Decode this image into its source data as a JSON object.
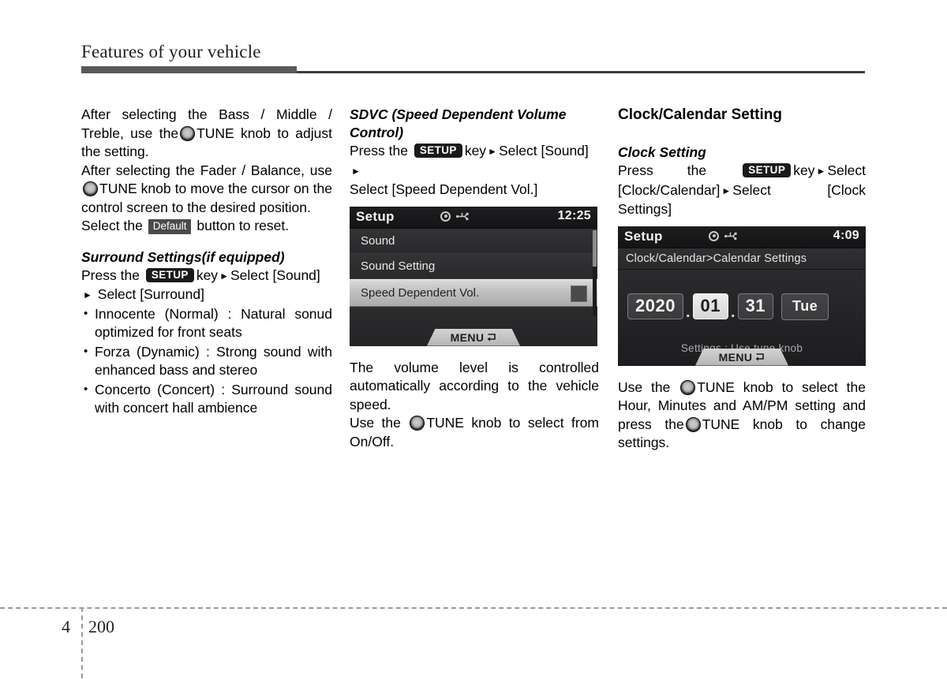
{
  "header": {
    "title": "Features of your vehicle"
  },
  "footer": {
    "chapter": "4",
    "page": "200"
  },
  "left_column": {
    "para1_a": "After selecting the Bass / Middle / Treble, use the",
    "para1_knob": "tune-knob",
    "para1_b": "TUNE knob to adjust the setting.",
    "para2_a": "After selecting the Fader / Balance, use",
    "para2_b": "TUNE knob to move the cursor on the control screen to the desired position.",
    "para3_a": "Select the",
    "para3_badge": "Default",
    "para3_b": "button to reset.",
    "surround_heading": "Surround Settings(if equipped)",
    "surround_press": "Press the",
    "surround_key": "SETUP",
    "surround_step1": "key",
    "surround_step2": "Select [Sound]",
    "surround_step3": "Select [Surround]",
    "surround_items": [
      "Innocente (Normal) : Natural sonud optimized for front seats",
      "Forza (Dynamic) : Strong sound with enhanced bass and stereo",
      "Concerto (Concert) : Surround sound with concert hall ambience"
    ]
  },
  "middle_column": {
    "sdvc_heading": "SDVC (Speed Dependent Volume Control)",
    "sdvc_press": "Press the",
    "sdvc_key": "SETUP",
    "sdvc_step1": "key",
    "sdvc_step2": "Select [Sound]",
    "sdvc_step3": "Select [Speed Dependent Vol.]",
    "caption_a": "The volume level is controlled automatically according to the vehicle speed.",
    "caption_b_pre": "Use  the",
    "caption_b_post": "TUNE knob to select from On/Off."
  },
  "middle_screen": {
    "title": "Setup",
    "time": "12:25",
    "disc_icon": "disc-icon",
    "usb_icon": "usb-icon",
    "rows": [
      {
        "label": "Sound",
        "selected": false
      },
      {
        "label": "Sound Setting",
        "selected": false
      },
      {
        "label": "Speed Dependent Vol.",
        "selected": true
      }
    ],
    "menu_label": "MENU"
  },
  "right_column": {
    "section_heading": "Clock/Calendar Setting",
    "clock_heading": "Clock Setting",
    "clock_press": "Press  the",
    "clock_key": "SETUP",
    "clock_step1": "key",
    "clock_step2": "Select  [Clock/Calendar]",
    "clock_step3": "Select [Clock Settings]",
    "caption_pre": "Use   the",
    "caption_mid": "TUNE knob to select the Hour, Minutes and AM/PM setting and press the",
    "caption_post": "TUNE knob to change settings."
  },
  "right_screen": {
    "title": "Setup",
    "time": "4:09",
    "breadcrumb": "Clock/Calendar>Calendar Settings",
    "date": {
      "year": "2020",
      "separator1": ".",
      "month": "01",
      "separator2": ".",
      "day": "31",
      "weekday": "Tue",
      "selected_field": "month"
    },
    "hint": "Settings : Use tune knob",
    "menu_label": "MENU"
  },
  "colors": {
    "rule": "#58595b",
    "screen_bg": "#2e2e30",
    "highlight": "#bdbdbd",
    "badge_dark": "#1a1a1a"
  }
}
